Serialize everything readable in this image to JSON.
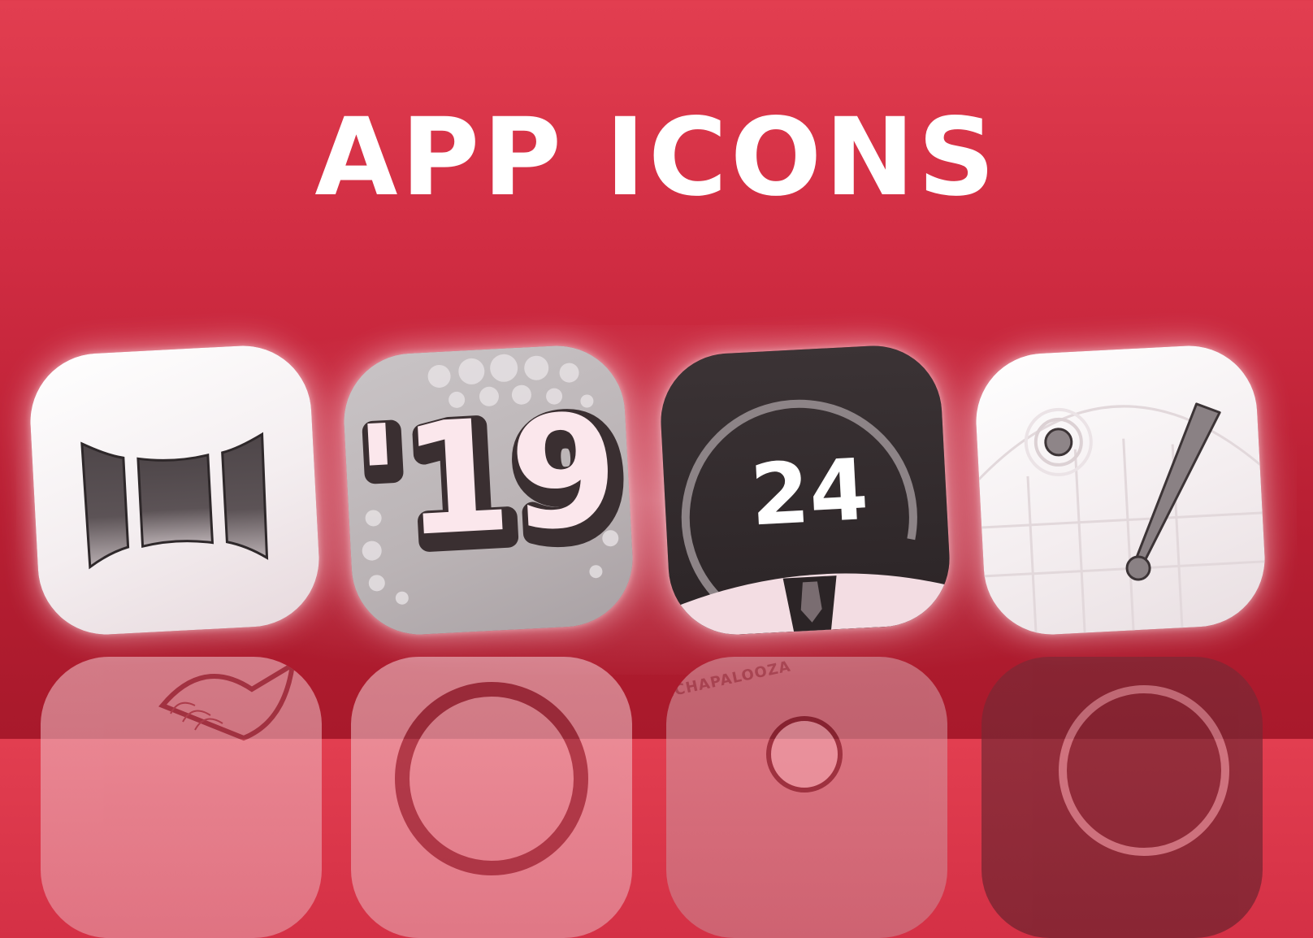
{
  "heading": {
    "title": "APP ICONS"
  },
  "icons": [
    {
      "name": "panorama-icon",
      "label": ""
    },
    {
      "name": "nineteen-icon",
      "label": "'19"
    },
    {
      "name": "twenty-four-icon",
      "label": "24"
    },
    {
      "name": "gauge-needle-icon",
      "label": ""
    }
  ],
  "reflections": {
    "techapalooza_text": "TECHAPALOOZA"
  },
  "colors": {
    "background_top": "#e23e50",
    "background_bottom": "#a8192b",
    "title": "#ffffff",
    "icon_dark": "#3b3335",
    "icon_light": "#ffffff"
  }
}
